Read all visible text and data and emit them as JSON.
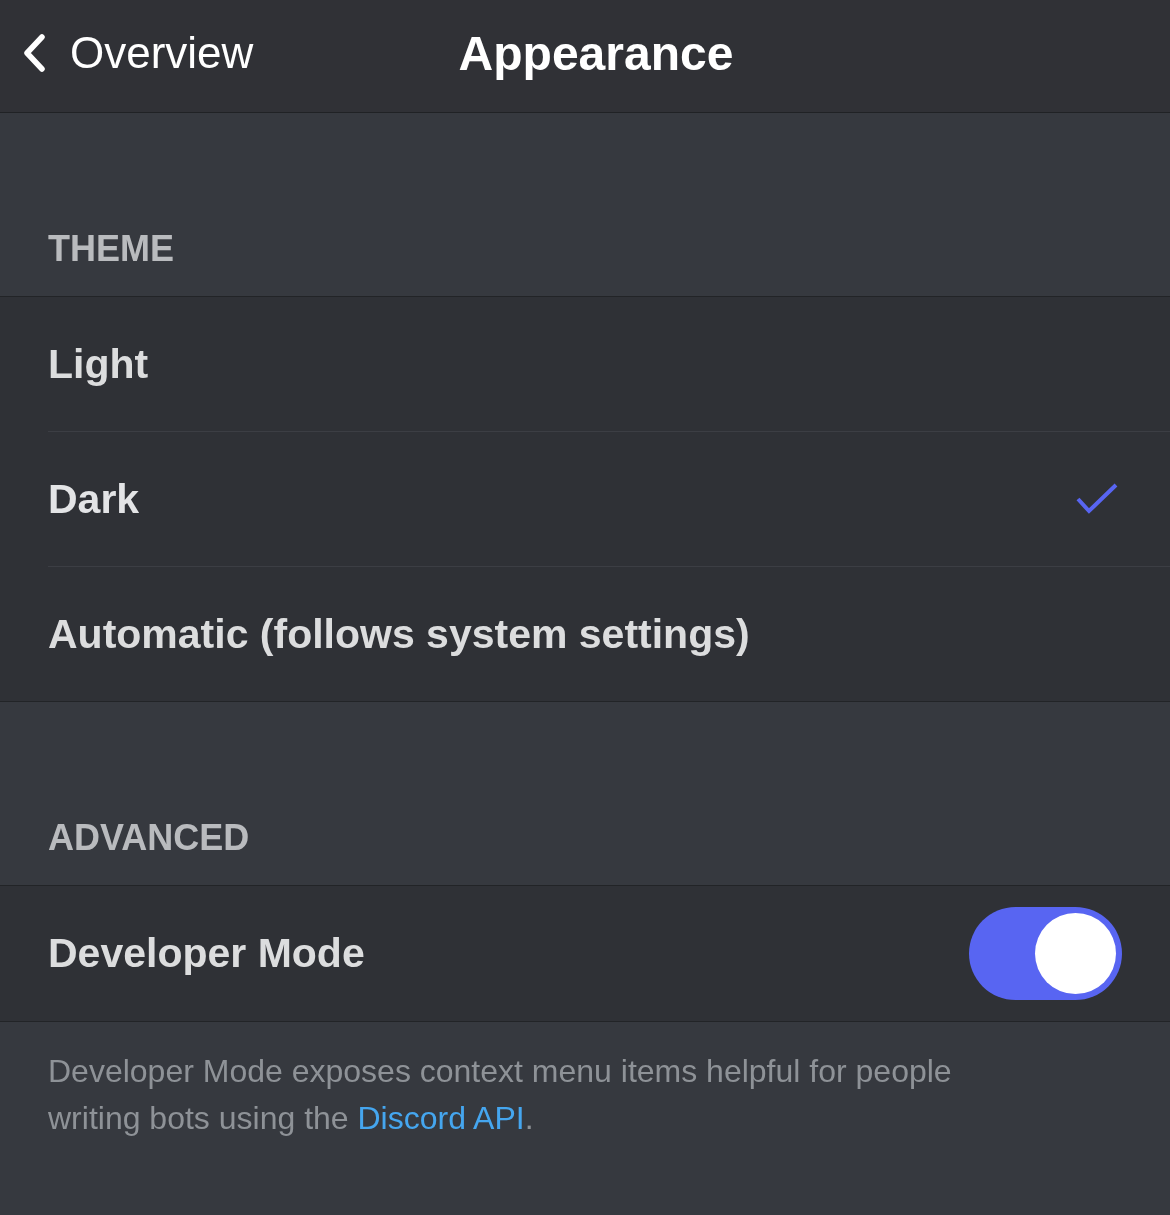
{
  "header": {
    "back_label": "Overview",
    "title": "Appearance"
  },
  "sections": [
    {
      "title": "THEME",
      "items": [
        {
          "kind": "option",
          "label": "Light",
          "selected": false
        },
        {
          "kind": "option",
          "label": "Dark",
          "selected": true
        },
        {
          "kind": "option",
          "label": "Automatic (follows system settings)",
          "selected": false
        }
      ]
    },
    {
      "title": "ADVANCED",
      "items": [
        {
          "kind": "toggle",
          "label": "Developer Mode",
          "on": true
        }
      ],
      "note": {
        "text": "Developer Mode exposes context menu items helpful for people writing bots using the ",
        "link": "Discord API",
        "after": "."
      }
    }
  ]
}
